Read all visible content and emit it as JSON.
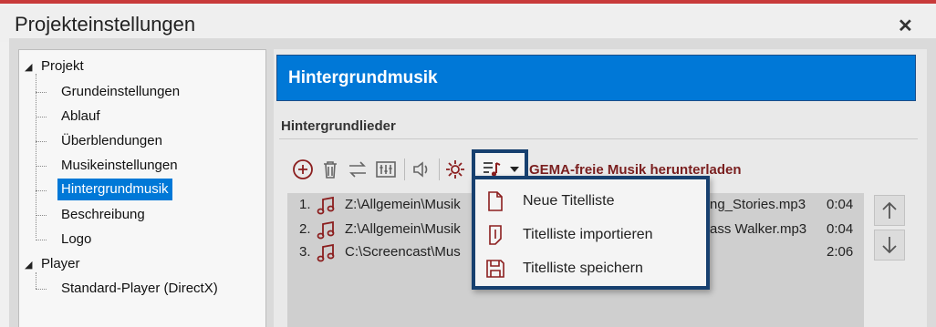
{
  "window": {
    "title": "Projekteinstellungen",
    "close_glyph": "✕"
  },
  "tree": {
    "groups": [
      {
        "label": "Projekt",
        "children": [
          "Grundeinstellungen",
          "Ablauf",
          "Überblendungen",
          "Musikeinstellungen",
          "Hintergrundmusik",
          "Beschreibung",
          "Logo"
        ]
      },
      {
        "label": "Player",
        "children": [
          "Standard-Player (DirectX)"
        ]
      }
    ],
    "selected": "Hintergrundmusik"
  },
  "panel": {
    "header": "Hintergrundmusik",
    "section_title": "Hintergrundlieder",
    "gema_link": "GEMA-freie Musik herunterladen"
  },
  "toolbar": {
    "icons": [
      "add-icon",
      "delete-icon",
      "swap-icon",
      "equalizer-icon",
      "volume-icon",
      "settings-icon",
      "playlist-icon"
    ]
  },
  "tracks": [
    {
      "num": "1.",
      "path": "Z:\\Allgemein\\Musik",
      "tail": "ng_Stories.mp3",
      "duration": "0:04"
    },
    {
      "num": "2.",
      "path": "Z:\\Allgemein\\Musik",
      "tail": "ass Walker.mp3",
      "duration": "0:04"
    },
    {
      "num": "3.",
      "path": "C:\\Screencast\\Mus",
      "tail": "",
      "duration": "2:06"
    }
  ],
  "menu": {
    "items": [
      {
        "label": "Neue Titelliste",
        "icon": "new-file-icon"
      },
      {
        "label": "Titelliste importieren",
        "icon": "import-icon"
      },
      {
        "label": "Titelliste speichern",
        "icon": "save-icon"
      }
    ]
  },
  "colors": {
    "accent": "#0078d7",
    "menu_border": "#17406f",
    "music_icon": "#8b1e1e",
    "gema": "#7a1f1f"
  }
}
